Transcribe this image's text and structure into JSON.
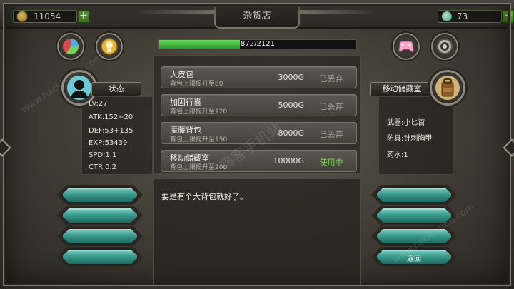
{
  "header": {
    "title": "杂货店",
    "gold": "11054",
    "gems": "73",
    "plus_label": "+"
  },
  "capacity": {
    "text": "872/2121",
    "fraction": 0.411
  },
  "shop_items": [
    {
      "name": "大皮包",
      "desc": "背包上限提升至80",
      "price": "3000G",
      "status": "已丢弃",
      "active": false
    },
    {
      "name": "加固行囊",
      "desc": "背包上限提升至120",
      "price": "5000G",
      "status": "已丢弃",
      "active": false
    },
    {
      "name": "魔藤背包",
      "desc": "背包上限提升至150",
      "price": "8000G",
      "status": "已丢弃",
      "active": false
    },
    {
      "name": "移动储藏室",
      "desc": "背包上限提升至200",
      "price": "10000G",
      "status": "使用中",
      "active": true
    }
  ],
  "dialog": {
    "text": "要是有个大背包就好了。"
  },
  "left_panel": {
    "label": "状态",
    "stats": [
      "LV:27",
      "ATK:152+20",
      "DEF:53+135",
      "EXP:53439",
      "SPD:1.1",
      "CTR:0.2"
    ]
  },
  "right_panel": {
    "label": "移动储藏室",
    "equipment": [
      "武器:小匕首",
      "防具:针刺胸甲",
      "药水:1"
    ]
  },
  "right_buttons": {
    "back_label": "返回"
  },
  "colors": {
    "progress": "#3ec53b",
    "active_status": "#7de34e",
    "teal_button": "#3b9c8f"
  },
  "icons": {
    "left_top_1": "pie-chart-icon",
    "left_top_2": "trophy-medal-icon",
    "right_top_1": "gamepad-icon",
    "right_top_2": "settings-gear-icon",
    "left_portrait": "hero-silhouette-icon",
    "right_portrait": "backpack-icon"
  },
  "watermark": {
    "main": "嗨客手机站",
    "url": "www.hackhome.com"
  }
}
